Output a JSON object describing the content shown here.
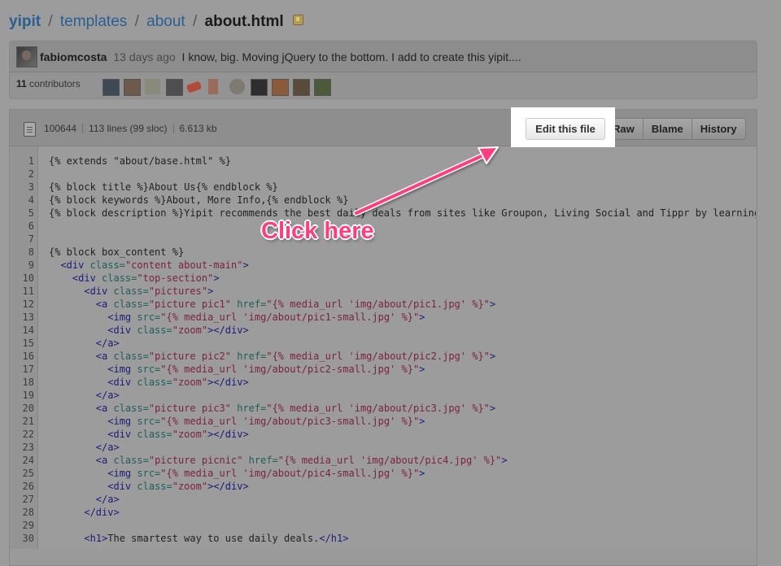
{
  "breadcrumb": {
    "repo": "yipit",
    "folder1": "templates",
    "folder2": "about",
    "file": "about.html",
    "separator": "/"
  },
  "commit": {
    "author": "fabiomcosta",
    "time": "13 days ago",
    "message": "I know, big. Moving jQuery to the bottom. I add to create this yipit...."
  },
  "contributors": {
    "count": "11",
    "label": "contributors"
  },
  "file_info": {
    "mode": "100644",
    "lines": "113 lines (99 sloc)",
    "size": "6.613 kb"
  },
  "buttons": {
    "edit": "Edit this file",
    "raw": "Raw",
    "blame": "Blame",
    "history": "History"
  },
  "annotation": {
    "text": "Click here",
    "color": "#ff3e7f"
  },
  "code_lines": [
    {
      "n": "1",
      "parts": [
        [
          "{% extends \"about/base.html\" %}",
          "t"
        ]
      ]
    },
    {
      "n": "2",
      "parts": []
    },
    {
      "n": "3",
      "parts": [
        [
          "{% block title %}About Us{% endblock %}",
          "t"
        ]
      ]
    },
    {
      "n": "4",
      "parts": [
        [
          "{% block keywords %}About, More Info,{% endblock %}",
          "t"
        ]
      ]
    },
    {
      "n": "5",
      "parts": [
        [
          "{% block description %}Yipit recommends the best daily deals from sites like Groupon, Living Social and Tippr by learning yo",
          "t"
        ]
      ]
    },
    {
      "n": "6",
      "parts": []
    },
    {
      "n": "7",
      "parts": []
    },
    {
      "n": "8",
      "parts": [
        [
          "{% block box_content %}",
          "t"
        ]
      ]
    },
    {
      "n": "9",
      "parts": [
        [
          "  ",
          "t"
        ],
        [
          "<div ",
          "tg"
        ],
        [
          "class=",
          "at"
        ],
        [
          "\"content about-main\"",
          "sv"
        ],
        [
          ">",
          "tg"
        ]
      ]
    },
    {
      "n": "10",
      "parts": [
        [
          "    ",
          "t"
        ],
        [
          "<div ",
          "tg"
        ],
        [
          "class=",
          "at"
        ],
        [
          "\"top-section\"",
          "sv"
        ],
        [
          ">",
          "tg"
        ]
      ]
    },
    {
      "n": "11",
      "parts": [
        [
          "      ",
          "t"
        ],
        [
          "<div ",
          "tg"
        ],
        [
          "class=",
          "at"
        ],
        [
          "\"pictures\"",
          "sv"
        ],
        [
          ">",
          "tg"
        ]
      ]
    },
    {
      "n": "12",
      "parts": [
        [
          "        ",
          "t"
        ],
        [
          "<a ",
          "tg"
        ],
        [
          "class=",
          "at"
        ],
        [
          "\"picture pic1\"",
          "sv"
        ],
        [
          " href=",
          "at"
        ],
        [
          "\"{% media_url 'img/about/pic1.jpg' %}\"",
          "sv"
        ],
        [
          ">",
          "tg"
        ]
      ]
    },
    {
      "n": "13",
      "parts": [
        [
          "          ",
          "t"
        ],
        [
          "<img ",
          "tg"
        ],
        [
          "src=",
          "at"
        ],
        [
          "\"{% media_url 'img/about/pic1-small.jpg' %}\"",
          "sv"
        ],
        [
          ">",
          "tg"
        ]
      ]
    },
    {
      "n": "14",
      "parts": [
        [
          "          ",
          "t"
        ],
        [
          "<div ",
          "tg"
        ],
        [
          "class=",
          "at"
        ],
        [
          "\"zoom\"",
          "sv"
        ],
        [
          "></div>",
          "tg"
        ]
      ]
    },
    {
      "n": "15",
      "parts": [
        [
          "        ",
          "t"
        ],
        [
          "</a>",
          "tg"
        ]
      ]
    },
    {
      "n": "16",
      "parts": [
        [
          "        ",
          "t"
        ],
        [
          "<a ",
          "tg"
        ],
        [
          "class=",
          "at"
        ],
        [
          "\"picture pic2\"",
          "sv"
        ],
        [
          " href=",
          "at"
        ],
        [
          "\"{% media_url 'img/about/pic2.jpg' %}\"",
          "sv"
        ],
        [
          ">",
          "tg"
        ]
      ]
    },
    {
      "n": "17",
      "parts": [
        [
          "          ",
          "t"
        ],
        [
          "<img ",
          "tg"
        ],
        [
          "src=",
          "at"
        ],
        [
          "\"{% media_url 'img/about/pic2-small.jpg' %}\"",
          "sv"
        ],
        [
          ">",
          "tg"
        ]
      ]
    },
    {
      "n": "18",
      "parts": [
        [
          "          ",
          "t"
        ],
        [
          "<div ",
          "tg"
        ],
        [
          "class=",
          "at"
        ],
        [
          "\"zoom\"",
          "sv"
        ],
        [
          "></div>",
          "tg"
        ]
      ]
    },
    {
      "n": "19",
      "parts": [
        [
          "        ",
          "t"
        ],
        [
          "</a>",
          "tg"
        ]
      ]
    },
    {
      "n": "20",
      "parts": [
        [
          "        ",
          "t"
        ],
        [
          "<a ",
          "tg"
        ],
        [
          "class=",
          "at"
        ],
        [
          "\"picture pic3\"",
          "sv"
        ],
        [
          " href=",
          "at"
        ],
        [
          "\"{% media_url 'img/about/pic3.jpg' %}\"",
          "sv"
        ],
        [
          ">",
          "tg"
        ]
      ]
    },
    {
      "n": "21",
      "parts": [
        [
          "          ",
          "t"
        ],
        [
          "<img ",
          "tg"
        ],
        [
          "src=",
          "at"
        ],
        [
          "\"{% media_url 'img/about/pic3-small.jpg' %}\"",
          "sv"
        ],
        [
          ">",
          "tg"
        ]
      ]
    },
    {
      "n": "22",
      "parts": [
        [
          "          ",
          "t"
        ],
        [
          "<div ",
          "tg"
        ],
        [
          "class=",
          "at"
        ],
        [
          "\"zoom\"",
          "sv"
        ],
        [
          "></div>",
          "tg"
        ]
      ]
    },
    {
      "n": "23",
      "parts": [
        [
          "        ",
          "t"
        ],
        [
          "</a>",
          "tg"
        ]
      ]
    },
    {
      "n": "24",
      "parts": [
        [
          "        ",
          "t"
        ],
        [
          "<a ",
          "tg"
        ],
        [
          "class=",
          "at"
        ],
        [
          "\"picture picnic\"",
          "sv"
        ],
        [
          " href=",
          "at"
        ],
        [
          "\"{% media_url 'img/about/pic4.jpg' %}\"",
          "sv"
        ],
        [
          ">",
          "tg"
        ]
      ]
    },
    {
      "n": "25",
      "parts": [
        [
          "          ",
          "t"
        ],
        [
          "<img ",
          "tg"
        ],
        [
          "src=",
          "at"
        ],
        [
          "\"{% media_url 'img/about/pic4-small.jpg' %}\"",
          "sv"
        ],
        [
          ">",
          "tg"
        ]
      ]
    },
    {
      "n": "26",
      "parts": [
        [
          "          ",
          "t"
        ],
        [
          "<div ",
          "tg"
        ],
        [
          "class=",
          "at"
        ],
        [
          "\"zoom\"",
          "sv"
        ],
        [
          "></div>",
          "tg"
        ]
      ]
    },
    {
      "n": "27",
      "parts": [
        [
          "        ",
          "t"
        ],
        [
          "</a>",
          "tg"
        ]
      ]
    },
    {
      "n": "28",
      "parts": [
        [
          "      ",
          "t"
        ],
        [
          "</div>",
          "tg"
        ]
      ]
    },
    {
      "n": "29",
      "parts": []
    },
    {
      "n": "30",
      "parts": [
        [
          "      ",
          "t"
        ],
        [
          "<h1>",
          "tg"
        ],
        [
          "The smartest way to use daily deals.",
          "t"
        ],
        [
          "</h1>",
          "tg"
        ]
      ]
    }
  ]
}
